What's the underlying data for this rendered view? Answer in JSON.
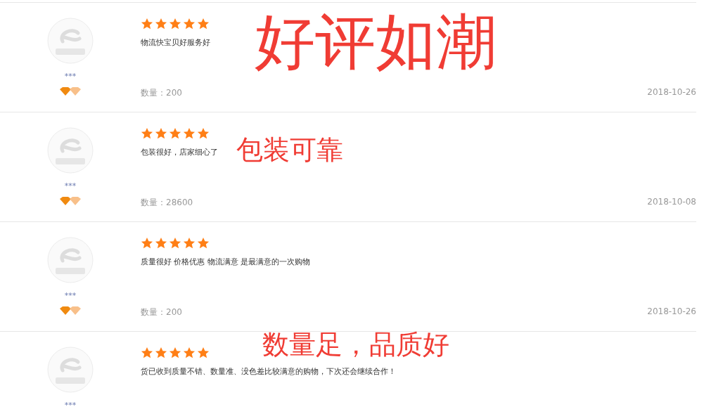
{
  "reviews": [
    {
      "user": "***",
      "stars": 5,
      "comment": "物流快宝贝好服务好",
      "quantity": "数量：200",
      "date": "2018-10-26",
      "annotation": "好评如潮"
    },
    {
      "user": "***",
      "stars": 5,
      "comment": "包装很好，店家细心了",
      "quantity": "数量：28600",
      "date": "2018-10-08",
      "annotation": "包装可靠"
    },
    {
      "user": "***",
      "stars": 5,
      "comment": "质量很好  价格优惠  物流满意  是最满意的一次购物",
      "quantity": "数量：200",
      "date": "2018-10-26"
    },
    {
      "user": "***",
      "stars": 5,
      "comment": "货已收到质量不错、数量准、没色差比较满意的购物，下次还会继续合作！",
      "annotation": "数量足，品质好"
    }
  ]
}
